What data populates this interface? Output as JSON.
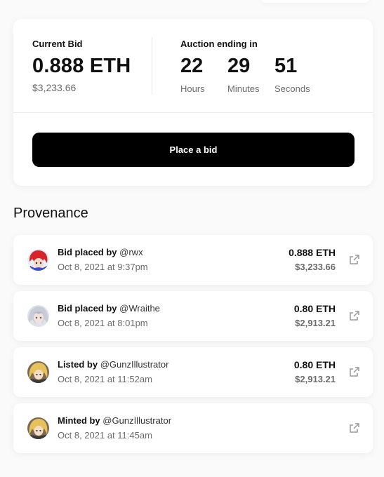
{
  "bid": {
    "current_label": "Current Bid",
    "current_eth": "0.888 ETH",
    "current_usd": "$3,233.66",
    "auction_label": "Auction ending in",
    "timer": [
      {
        "value": "22",
        "unit": "Hours"
      },
      {
        "value": "29",
        "unit": "Minutes"
      },
      {
        "value": "51",
        "unit": "Seconds"
      }
    ],
    "button_label": "Place a bid"
  },
  "provenance": {
    "title": "Provenance",
    "items": [
      {
        "action": "Bid placed by",
        "user": "@rwx",
        "date": "Oct 8, 2021 at 9:37pm",
        "eth": "0.888 ETH",
        "usd": "$3,233.66",
        "avatar": "red-hair-avatar"
      },
      {
        "action": "Bid placed by",
        "user": "@Wraithe",
        "date": "Oct 8, 2021 at 8:01pm",
        "eth": "0.80 ETH",
        "usd": "$2,913.21",
        "avatar": "silver-hair-avatar"
      },
      {
        "action": "Listed by",
        "user": "@GunzIllustrator",
        "date": "Oct 8, 2021 at 11:52am",
        "eth": "0.80 ETH",
        "usd": "$2,913.21",
        "avatar": "blonde-avatar"
      },
      {
        "action": "Minted by",
        "user": "@GunzIllustrator",
        "date": "Oct 8, 2021 at 11:45am",
        "eth": "",
        "usd": "",
        "avatar": "blonde-avatar"
      }
    ],
    "link_icon": "external-link-icon"
  }
}
